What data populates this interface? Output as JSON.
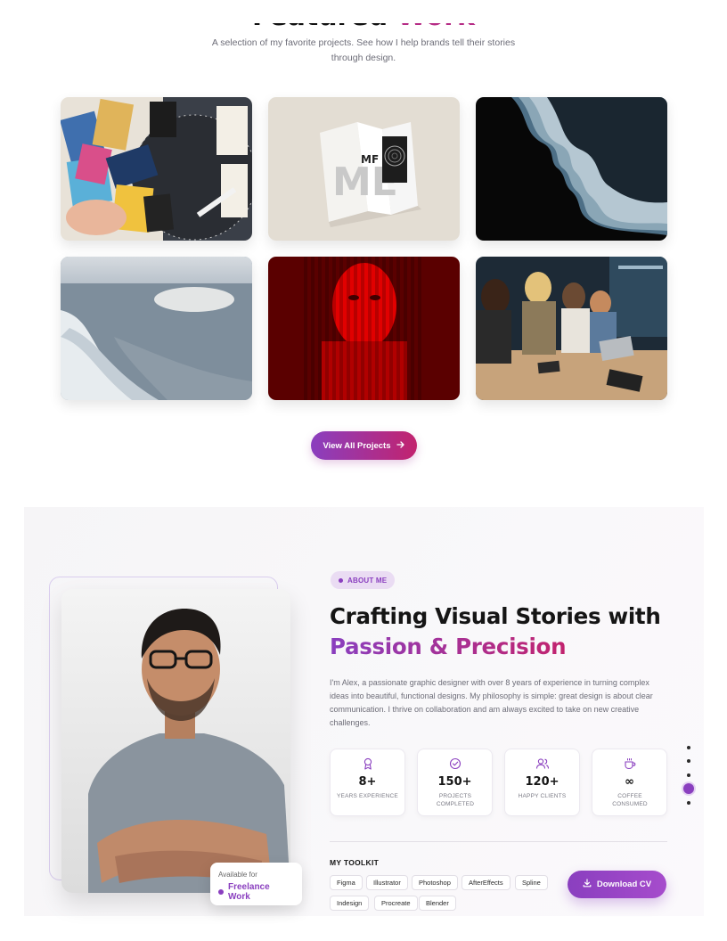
{
  "featured": {
    "title_prefix": "Featured",
    "title_accent": "Work",
    "subtitle": "A selection of my favorite projects. See how I help brands tell their stories through design.",
    "projects": [
      {
        "name": "photo-collage-project"
      },
      {
        "name": "brochure-mockup-project"
      },
      {
        "name": "particle-face-project"
      },
      {
        "name": "ocean-wake-project"
      },
      {
        "name": "red-glass-portrait-project"
      },
      {
        "name": "team-meeting-project"
      }
    ],
    "view_all_label": "View All Projects",
    "view_all_icon": "arrow-right-icon"
  },
  "about": {
    "badge": "ABOUT ME",
    "title_line1": "Crafting Visual Stories with",
    "title_line2": "Passion & Precision",
    "paragraph": "I'm Alex, a passionate graphic designer with over 8 years of experience in turning complex ideas into beautiful, functional designs. My philosophy is simple: great design is about clear communication. I thrive on collaboration and am always excited to take on new creative challenges.",
    "availability": {
      "label": "Available for",
      "value": "Freelance Work"
    },
    "stats": [
      {
        "icon": "award-icon",
        "value": "8+",
        "label": "YEARS EXPERIENCE"
      },
      {
        "icon": "check-circle-icon",
        "value": "150+",
        "label": "PROJECTS COMPLETED"
      },
      {
        "icon": "users-icon",
        "value": "120+",
        "label": "HAPPY CLIENTS"
      },
      {
        "icon": "coffee-icon",
        "value": "∞",
        "label": "COFFEE CONSUMED"
      }
    ],
    "toolkit_title": "MY TOOLKIT",
    "tools": [
      "Figma",
      "Illustrator",
      "Photoshop",
      "AfterEffects",
      "Spline",
      "Indesign",
      "Procreate",
      "Blender"
    ],
    "download_label": "Download CV",
    "download_icon": "download-icon"
  },
  "side_nav": {
    "count": 5,
    "active_index": 3
  },
  "colors": {
    "accent_purple": "#8a3fbf",
    "accent_magenta": "#c2236e"
  }
}
